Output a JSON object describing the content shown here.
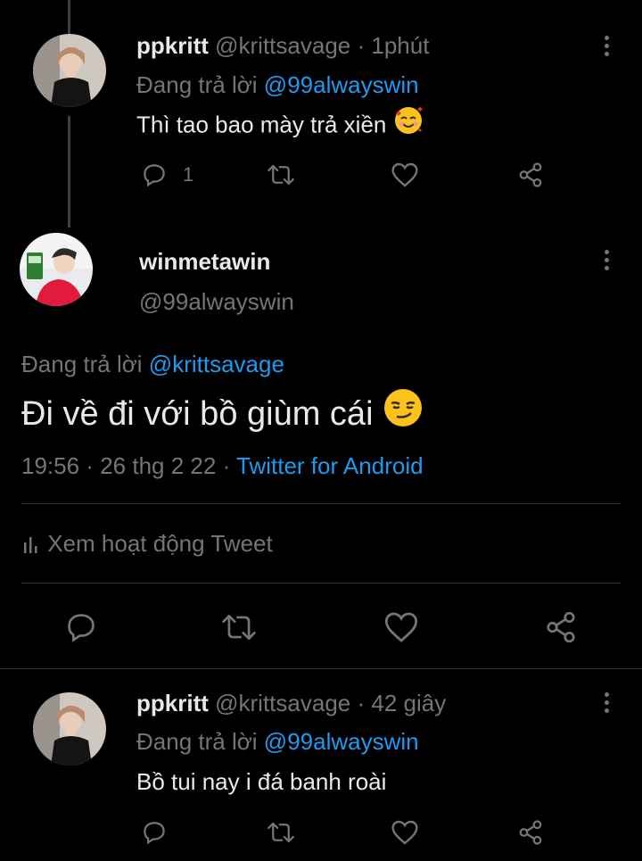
{
  "tweet1": {
    "name": "ppkritt",
    "handle": "@krittsavage",
    "sep": "·",
    "time": "1phút",
    "replying_prefix": "Đang trả lời",
    "replying_to": "@99alwayswin",
    "text": "Thì tao bao mày trả xiền",
    "emoji": "smiling-face-with-hearts",
    "reply_count": "1"
  },
  "main": {
    "name": "winmetawin",
    "handle": "@99alwayswin",
    "replying_prefix": "Đang trả lời",
    "replying_to": "@krittsavage",
    "text": "Đi về đi với bồ giùm cái",
    "emoji": "smirking-face",
    "time": "19:56",
    "sep": "·",
    "date": "26 thg 2 22",
    "source": "Twitter for Android",
    "activity_label": "Xem hoạt động Tweet"
  },
  "tweet2": {
    "name": "ppkritt",
    "handle": "@krittsavage",
    "sep": "·",
    "time": "42 giây",
    "replying_prefix": "Đang trả lời",
    "replying_to": "@99alwayswin",
    "text": "Bồ tui nay i đá banh roài"
  },
  "colors": {
    "background": "#000000",
    "text": "#e7e9ea",
    "muted": "#71767b",
    "link": "#1d9bf0",
    "divider": "#2f3336"
  }
}
